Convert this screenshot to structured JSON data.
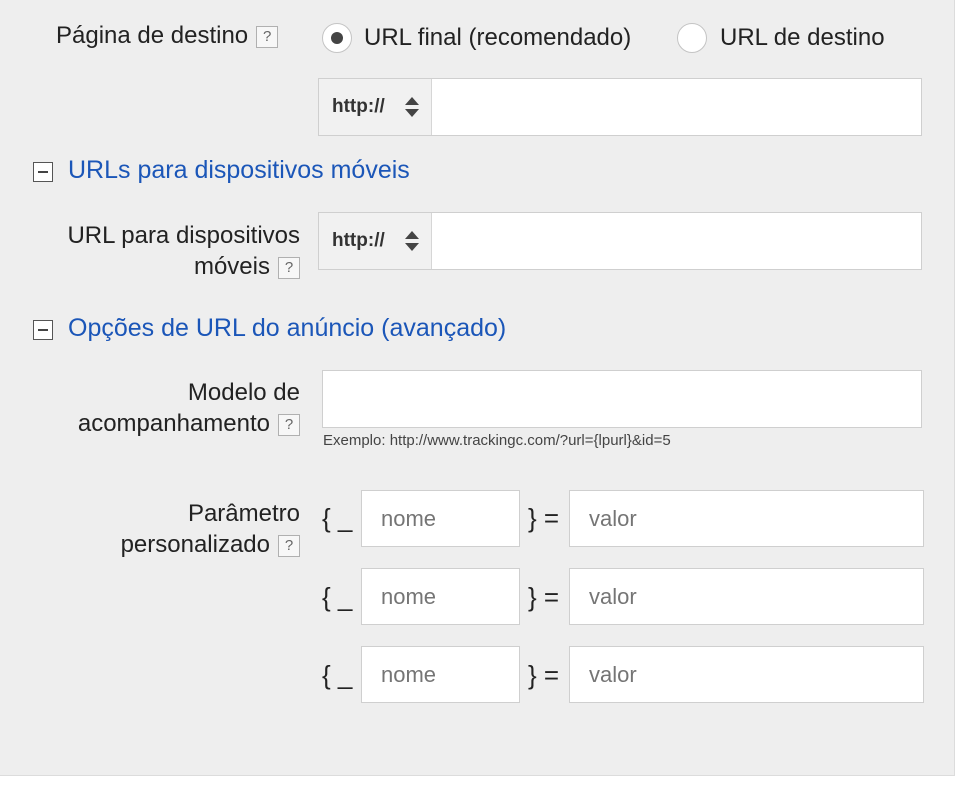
{
  "destination": {
    "label": "Página de destino",
    "help": "?",
    "options": [
      {
        "label": "URL final (recomendado)",
        "selected": true
      },
      {
        "label": "URL de destino",
        "selected": false
      }
    ],
    "protocol": "http://",
    "url_value": ""
  },
  "mobile_section": {
    "title": "URLs para dispositivos móveis",
    "label_line1": "URL para dispositivos",
    "label_line2": "móveis",
    "help": "?",
    "protocol": "http://",
    "url_value": ""
  },
  "ad_url_section": {
    "title": "Opções de URL do anúncio (avançado)",
    "tracking": {
      "label_line1": "Modelo de",
      "label_line2": "acompanhamento",
      "help": "?",
      "value": "",
      "example": "Exemplo: http://www.trackingc.com/?url={lpurl}&id=5"
    },
    "custom_params": {
      "label_line1": "Parâmetro",
      "label_line2": "personalizado",
      "help": "?",
      "open_brace": "{ _",
      "close_brace": "} =",
      "rows": [
        {
          "name_placeholder": "nome",
          "value_placeholder": "valor"
        },
        {
          "name_placeholder": "nome",
          "value_placeholder": "valor"
        },
        {
          "name_placeholder": "nome",
          "value_placeholder": "valor"
        }
      ]
    }
  }
}
